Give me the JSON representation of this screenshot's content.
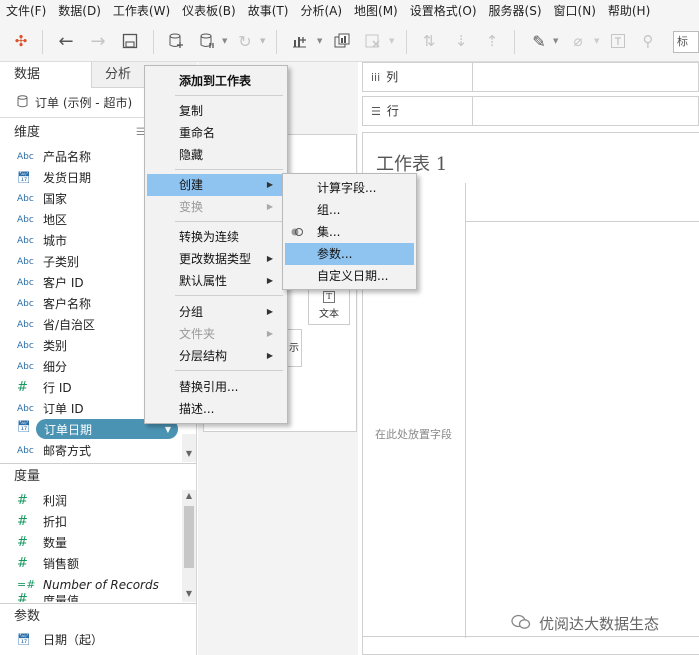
{
  "menubar": [
    "文件(F)",
    "数据(D)",
    "工作表(W)",
    "仪表板(B)",
    "故事(T)",
    "分析(A)",
    "地图(M)",
    "设置格式(O)",
    "服务器(S)",
    "窗口(N)",
    "帮助(H)"
  ],
  "toolbar": {
    "show_me_text": "标"
  },
  "left_pane": {
    "tabs": {
      "data": "数据",
      "analysis": "分析"
    },
    "datasource": "订单 (示例 - 超市)",
    "dimensions_header": "维度",
    "dimensions": [
      {
        "type": "Abc",
        "name": "产品名称"
      },
      {
        "type": "date",
        "name": "发货日期"
      },
      {
        "type": "Abc",
        "name": "国家"
      },
      {
        "type": "Abc",
        "name": "地区"
      },
      {
        "type": "Abc",
        "name": "城市"
      },
      {
        "type": "Abc",
        "name": "子类别"
      },
      {
        "type": "Abc",
        "name": "客户 ID"
      },
      {
        "type": "Abc",
        "name": "客户名称"
      },
      {
        "type": "Abc",
        "name": "省/自治区"
      },
      {
        "type": "Abc",
        "name": "类别"
      },
      {
        "type": "Abc",
        "name": "细分"
      },
      {
        "type": "#",
        "name": "行 ID"
      },
      {
        "type": "Abc",
        "name": "订单 ID"
      },
      {
        "type": "date",
        "name": "订单日期"
      },
      {
        "type": "Abc",
        "name": "邮寄方式"
      }
    ],
    "measures_header": "度量",
    "measures": [
      {
        "type": "#",
        "name": "利润"
      },
      {
        "type": "#",
        "name": "折扣"
      },
      {
        "type": "#",
        "name": "数量"
      },
      {
        "type": "#",
        "name": "销售额"
      },
      {
        "type": "=#",
        "name": "Number of Records"
      },
      {
        "type": "#",
        "name": "度量值"
      }
    ],
    "parameters_header": "参数",
    "parameters": [
      {
        "type": "date",
        "name": "日期（起）"
      }
    ]
  },
  "shelves": {
    "columns": "列",
    "rows": "行"
  },
  "marks_cards": {
    "text": "文本",
    "tooltip_partial": "示"
  },
  "canvas": {
    "title": "工作表 1",
    "drop_hint": "在此处放置字段",
    "watermark": "优阅达大数据生态"
  },
  "context_menu": {
    "items": [
      {
        "label": "添加到工作表",
        "bold": true
      },
      {
        "label": "复制"
      },
      {
        "label": "重命名"
      },
      {
        "label": "隐藏"
      },
      {
        "label": "创建",
        "submenu": true,
        "highlight": true
      },
      {
        "label": "变换",
        "submenu": true,
        "disabled": true
      },
      {
        "label": "转换为连续"
      },
      {
        "label": "更改数据类型",
        "submenu": true
      },
      {
        "label": "默认属性",
        "submenu": true
      },
      {
        "label": "分组",
        "submenu": true
      },
      {
        "label": "文件夹",
        "submenu": true,
        "disabled": true
      },
      {
        "label": "分层结构",
        "submenu": true
      },
      {
        "label": "替换引用..."
      },
      {
        "label": "描述..."
      }
    ]
  },
  "submenu": {
    "items": [
      {
        "label": "计算字段..."
      },
      {
        "label": "组..."
      },
      {
        "label": "集...",
        "icon": "set-icon"
      },
      {
        "label": "参数...",
        "highlight": true
      },
      {
        "label": "自定义日期..."
      }
    ]
  },
  "colors": {
    "selected_pill": "#4a93b3",
    "menu_highlight": "#8fc3f0",
    "measure_icon": "#1a9960",
    "dimension_icon": "#2b6ea8"
  }
}
